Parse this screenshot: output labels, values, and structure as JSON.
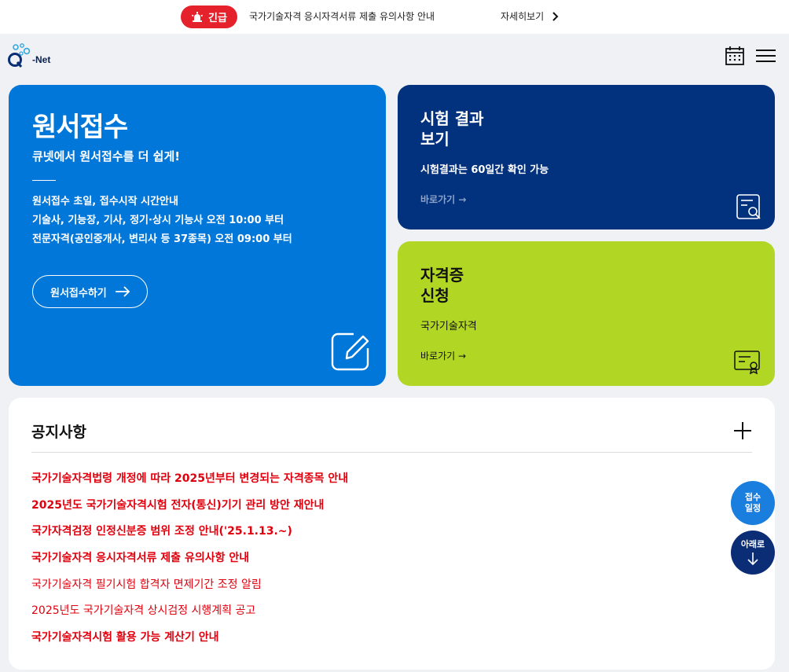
{
  "alert": {
    "badge": "긴급",
    "text": "국가기술자격 응시자격서류 제출 유의사항 안내",
    "more": "자세히보기"
  },
  "header": {
    "logo_text": "-Net",
    "calendar_icon": "calendar-icon",
    "menu_icon": "hamburger-menu-icon"
  },
  "apply_card": {
    "title": "원서접수",
    "subtitle": "큐넷에서 원서접수를 더 쉽게!",
    "info": [
      "원서접수 초일, 접수시작 시간안내",
      "기술사, 기능장, 기사, 정기·상시 기능사 오전 10:00 부터",
      "전문자격(공인중개사, 변리사 등 37종목) 오전 09:00 부터"
    ],
    "button": "원서접수하기",
    "color": "#0077d9"
  },
  "result_card": {
    "title_line1": "시험 결과",
    "title_line2": "보기",
    "subtitle": "시험결과는 60일간 확인 가능",
    "link": "바로가기 →",
    "color": "#02317e"
  },
  "cert_card": {
    "title_line1": "자격증",
    "title_line2": "신청",
    "subtitle": "국가기술자격",
    "link": "바로가기 →",
    "color": "#b1d624"
  },
  "notice": {
    "title": "공지사항",
    "items": [
      {
        "text": "국가기술자격법령 개정에 따라 2025년부터 변경되는 자격종목 안내",
        "bold": true
      },
      {
        "text": "2025년도 국가기술자격시험 전자(통신)기기 관리 방안 재안내",
        "bold": true
      },
      {
        "text": "국가자격검정 인정신분증 범위 조정 안내('25.1.13.~)",
        "bold": true
      },
      {
        "text": "국가기술자격 응시자격서류 제출 유의사항 안내",
        "bold": true
      },
      {
        "text": "국가기술자격 필기시험 합격자 면제기간 조정 알림",
        "bold": false
      },
      {
        "text": "2025년도 국가기술자격 상시검정 시행계획 공고",
        "bold": false
      },
      {
        "text": "국가기술자격시험 활용 가능 계산기 안내",
        "bold": true
      }
    ]
  },
  "fab": {
    "schedule_line1": "접수",
    "schedule_line2": "일정",
    "down_label": "아래로"
  }
}
